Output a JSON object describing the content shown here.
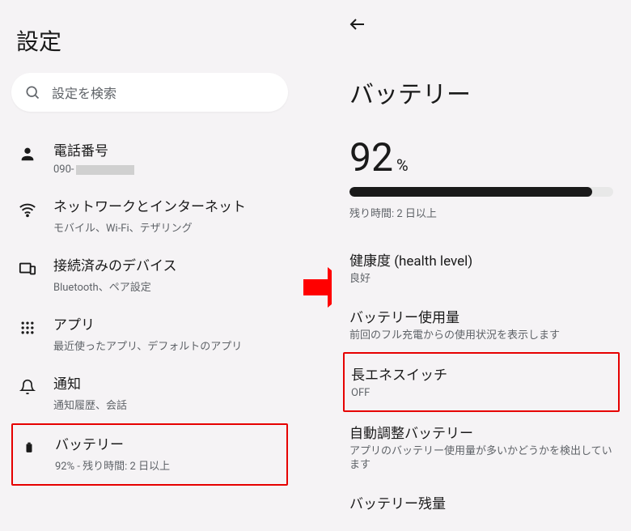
{
  "left": {
    "title": "設定",
    "search_placeholder": "設定を検索",
    "items": [
      {
        "title": "電話番号",
        "subtitle_prefix": "090-"
      },
      {
        "title": "ネットワークとインターネット",
        "subtitle": "モバイル、Wi-Fi、テザリング"
      },
      {
        "title": "接続済みのデバイス",
        "subtitle": "Bluetooth、ペア設定"
      },
      {
        "title": "アプリ",
        "subtitle": "最近使ったアプリ、デフォルトのアプリ"
      },
      {
        "title": "通知",
        "subtitle": "通知履歴、会話"
      },
      {
        "title": "バッテリー",
        "subtitle": "92% - 残り時間: 2 日以上"
      }
    ]
  },
  "right": {
    "title": "バッテリー",
    "percent_value": "92",
    "percent_symbol": "%",
    "percent_fill": "92%",
    "remaining": "残り時間: 2 日以上",
    "rows": [
      {
        "title": "健康度 (health level)",
        "sub": "良好"
      },
      {
        "title": "バッテリー使用量",
        "sub": "前回のフル充電からの使用状況を表示します"
      },
      {
        "title": "長エネスイッチ",
        "sub": "OFF"
      },
      {
        "title": "自動調整バッテリー",
        "sub": "アプリのバッテリー使用量が多いかどうかを検出しています"
      },
      {
        "title": "バッテリー残量",
        "sub": ""
      }
    ]
  }
}
